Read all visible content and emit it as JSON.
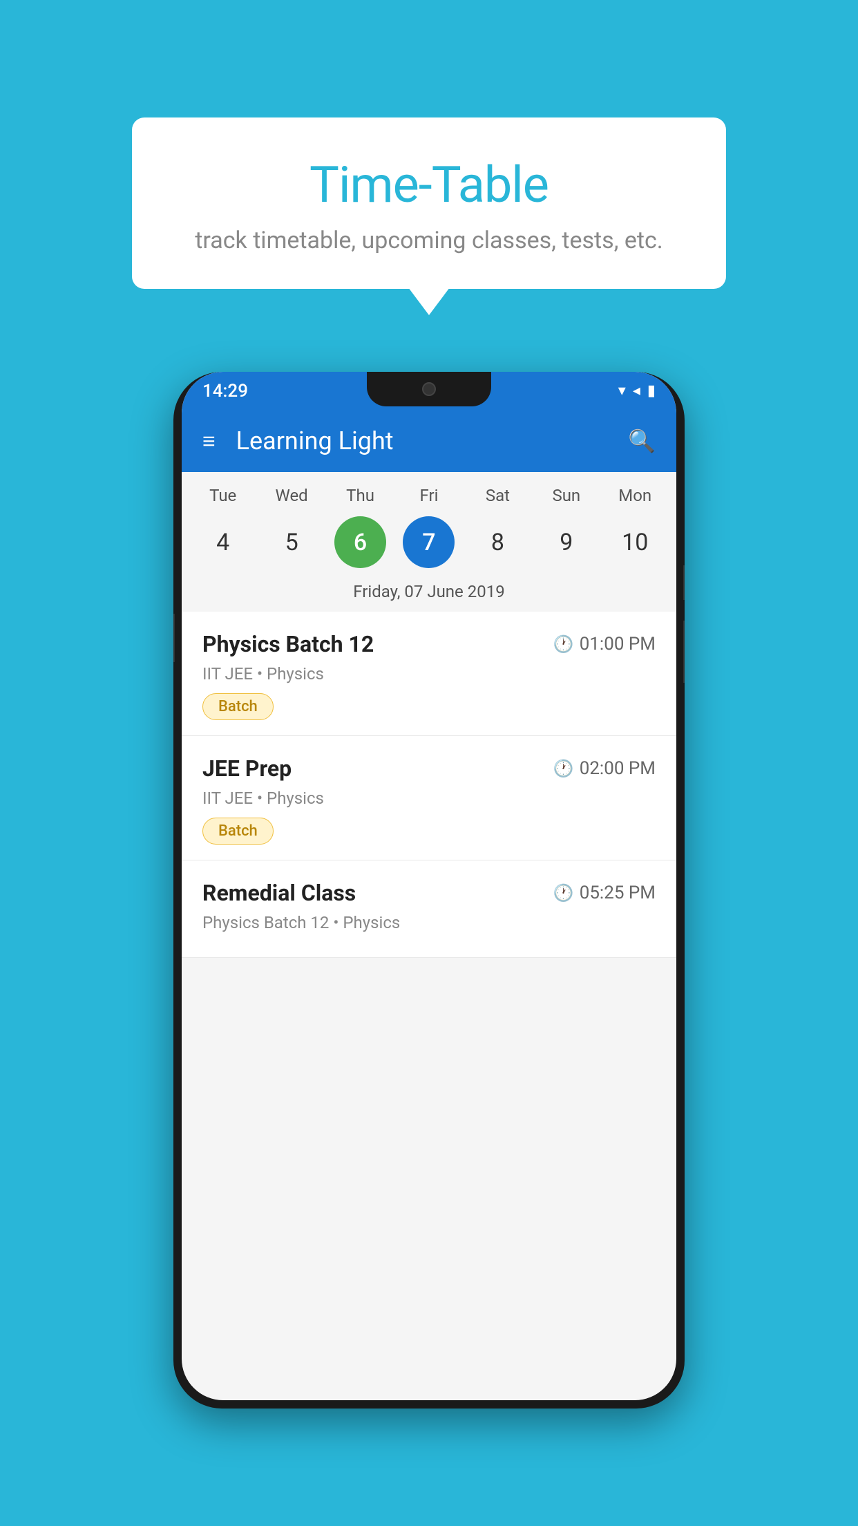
{
  "background_color": "#29B6D8",
  "tooltip": {
    "title": "Time-Table",
    "subtitle": "track timetable, upcoming classes, tests, etc."
  },
  "app": {
    "title": "Learning Light",
    "status_time": "14:29"
  },
  "calendar": {
    "days": [
      "Tue",
      "Wed",
      "Thu",
      "Fri",
      "Sat",
      "Sun",
      "Mon"
    ],
    "dates": [
      "4",
      "5",
      "6",
      "7",
      "8",
      "9",
      "10"
    ],
    "today_index": 2,
    "selected_index": 3,
    "selected_label": "Friday, 07 June 2019"
  },
  "schedule": [
    {
      "title": "Physics Batch 12",
      "time": "01:00 PM",
      "meta": "IIT JEE • Physics",
      "badge": "Batch"
    },
    {
      "title": "JEE Prep",
      "time": "02:00 PM",
      "meta": "IIT JEE • Physics",
      "badge": "Batch"
    },
    {
      "title": "Remedial Class",
      "time": "05:25 PM",
      "meta": "Physics Batch 12 • Physics",
      "badge": ""
    }
  ],
  "icons": {
    "hamburger": "≡",
    "search": "🔍",
    "clock": "🕐",
    "wifi": "▲",
    "signal": "▲",
    "battery": "▮"
  }
}
